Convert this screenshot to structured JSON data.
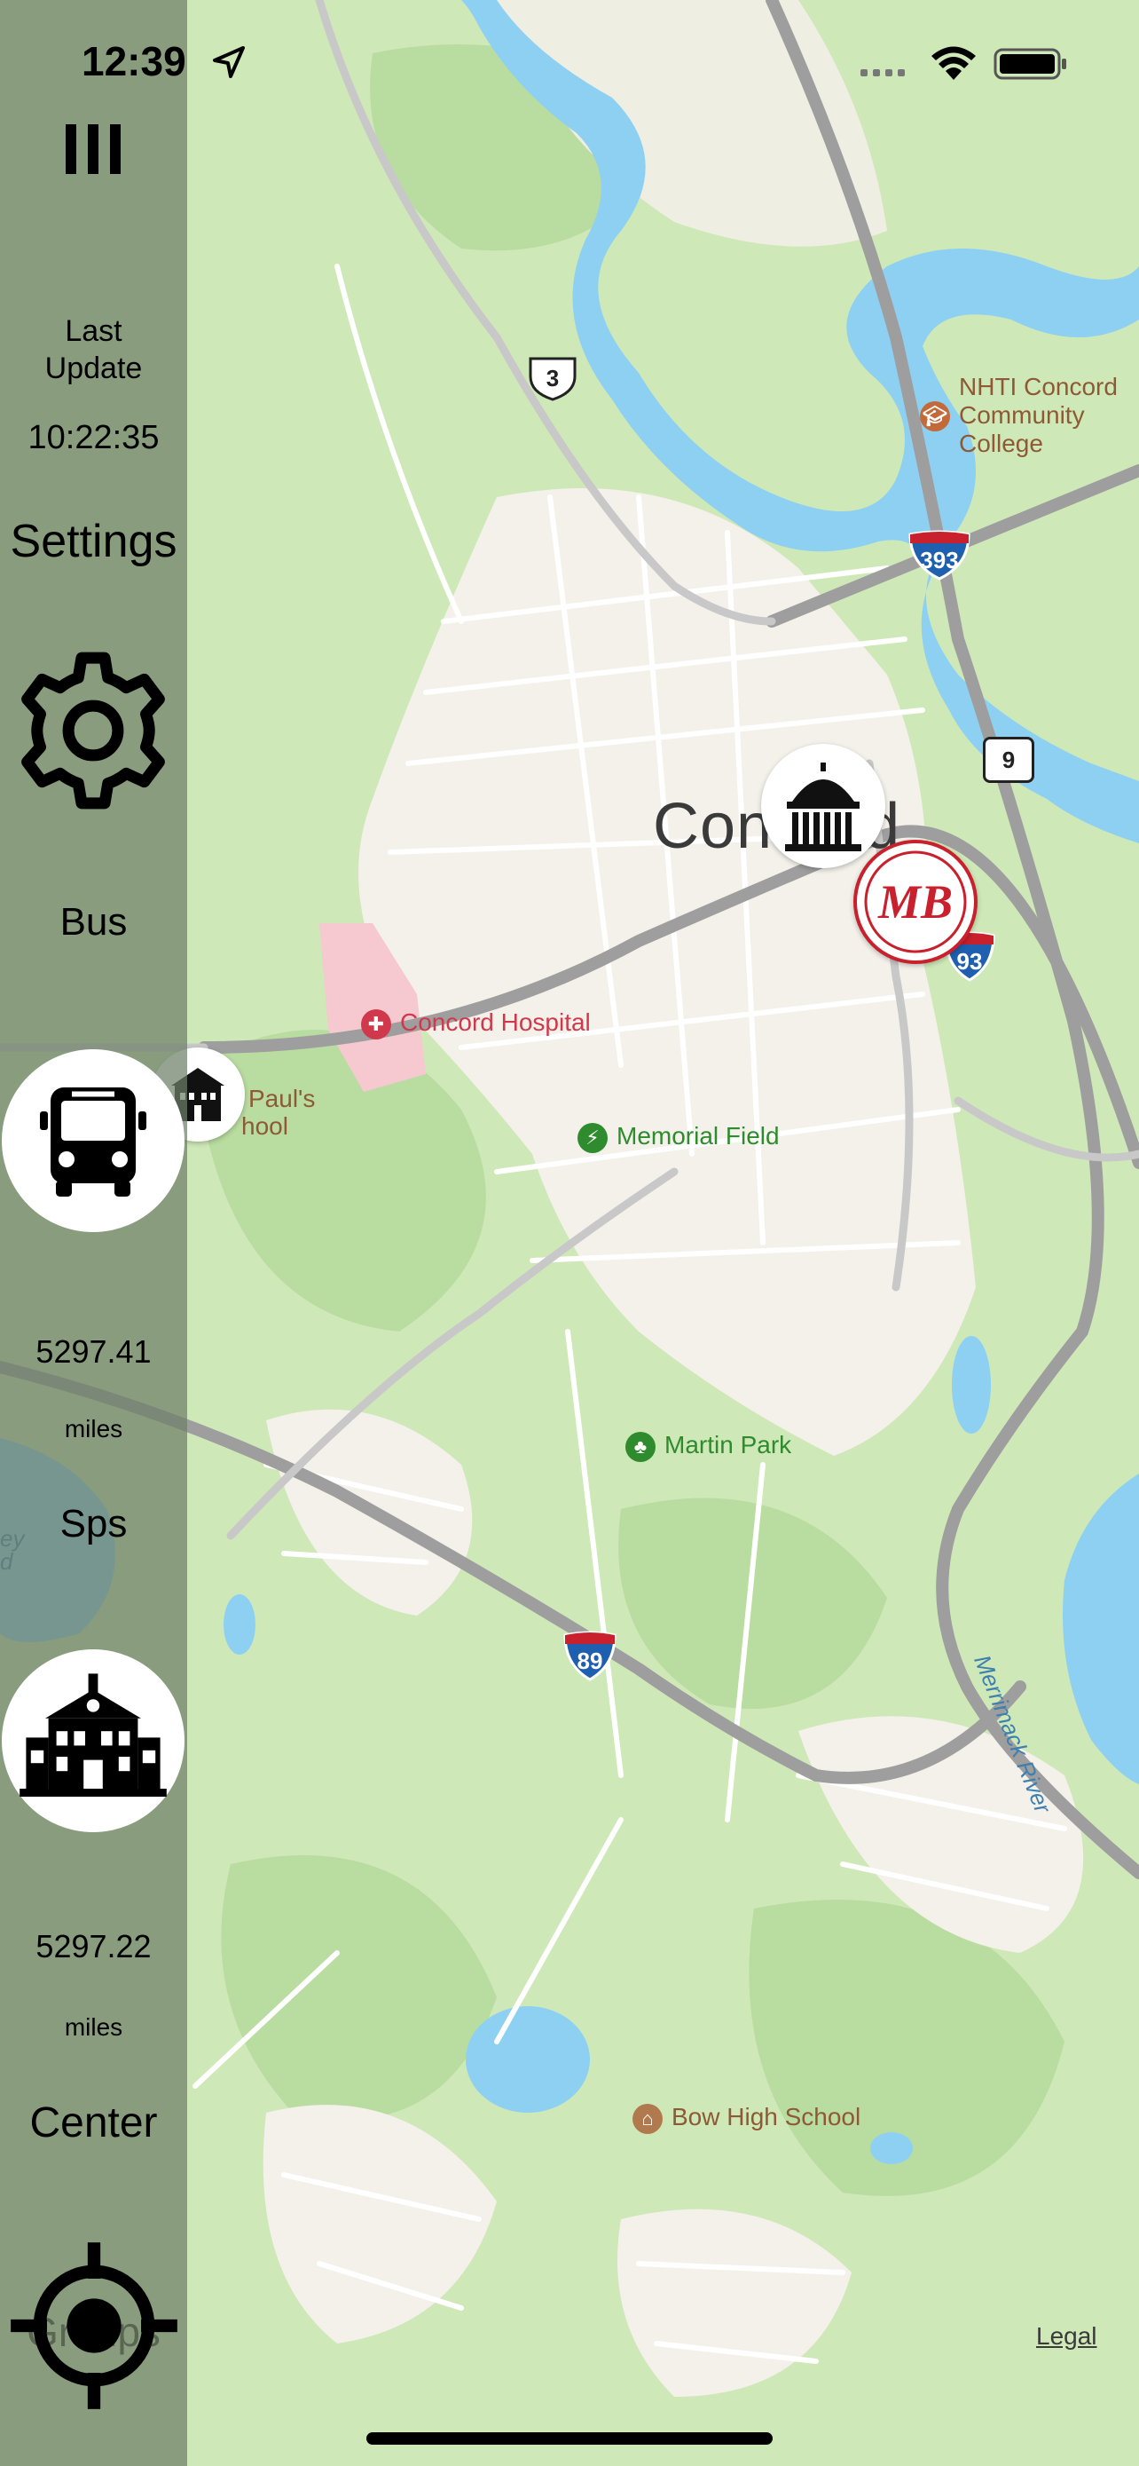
{
  "status_bar": {
    "time": "12:39"
  },
  "map": {
    "city_label": "Concord",
    "pois": {
      "hospital": "Concord Hospital",
      "memorial_field": "Memorial Field",
      "martin_park": "Martin Park",
      "bow_high_school": "Bow High School",
      "nhti_line1": "NHTI Concord",
      "nhti_line2": "Community",
      "nhti_line3": "College",
      "st_pauls_line1": "Paul's",
      "st_pauls_line2": "hool"
    },
    "river": "Merrimack River",
    "shields": {
      "us3": "3",
      "i393": "393",
      "i93": "93",
      "i89": "89",
      "nh9": "9"
    },
    "legal_link": "Legal",
    "partial_left_label_1": "ey",
    "partial_left_label_2": "d",
    "overlap_text": "Groups"
  },
  "sidebar": {
    "last_update_label_line1": "Last",
    "last_update_label_line2": "Update",
    "last_update_time": "10:22:35",
    "settings_label": "Settings",
    "bus_label": "Bus",
    "bus_distance": "5297.41",
    "bus_unit": "miles",
    "sps_label": "Sps",
    "sps_distance": "5297.22",
    "sps_unit": "miles",
    "center_label": "Center"
  },
  "colors": {
    "land": "#cfe8b8",
    "urban": "#f3f1ea",
    "water": "#8ed0f2",
    "road": "#ffffff",
    "highway": "#a9a9a9",
    "sidebar": "#6e8068",
    "interstate_blue": "#1f5fb0",
    "interstate_red": "#c8202c",
    "hospital_red": "#d0394b",
    "park_green": "#2e8b2e",
    "school_brown": "#8d5a35"
  },
  "icons": {
    "menu": "menu-icon",
    "settings": "gear-icon",
    "bus": "bus-icon",
    "school": "school-icon",
    "center": "crosshair-icon",
    "capitol": "capitol-icon",
    "mb_logo": "mb-logo-icon"
  }
}
